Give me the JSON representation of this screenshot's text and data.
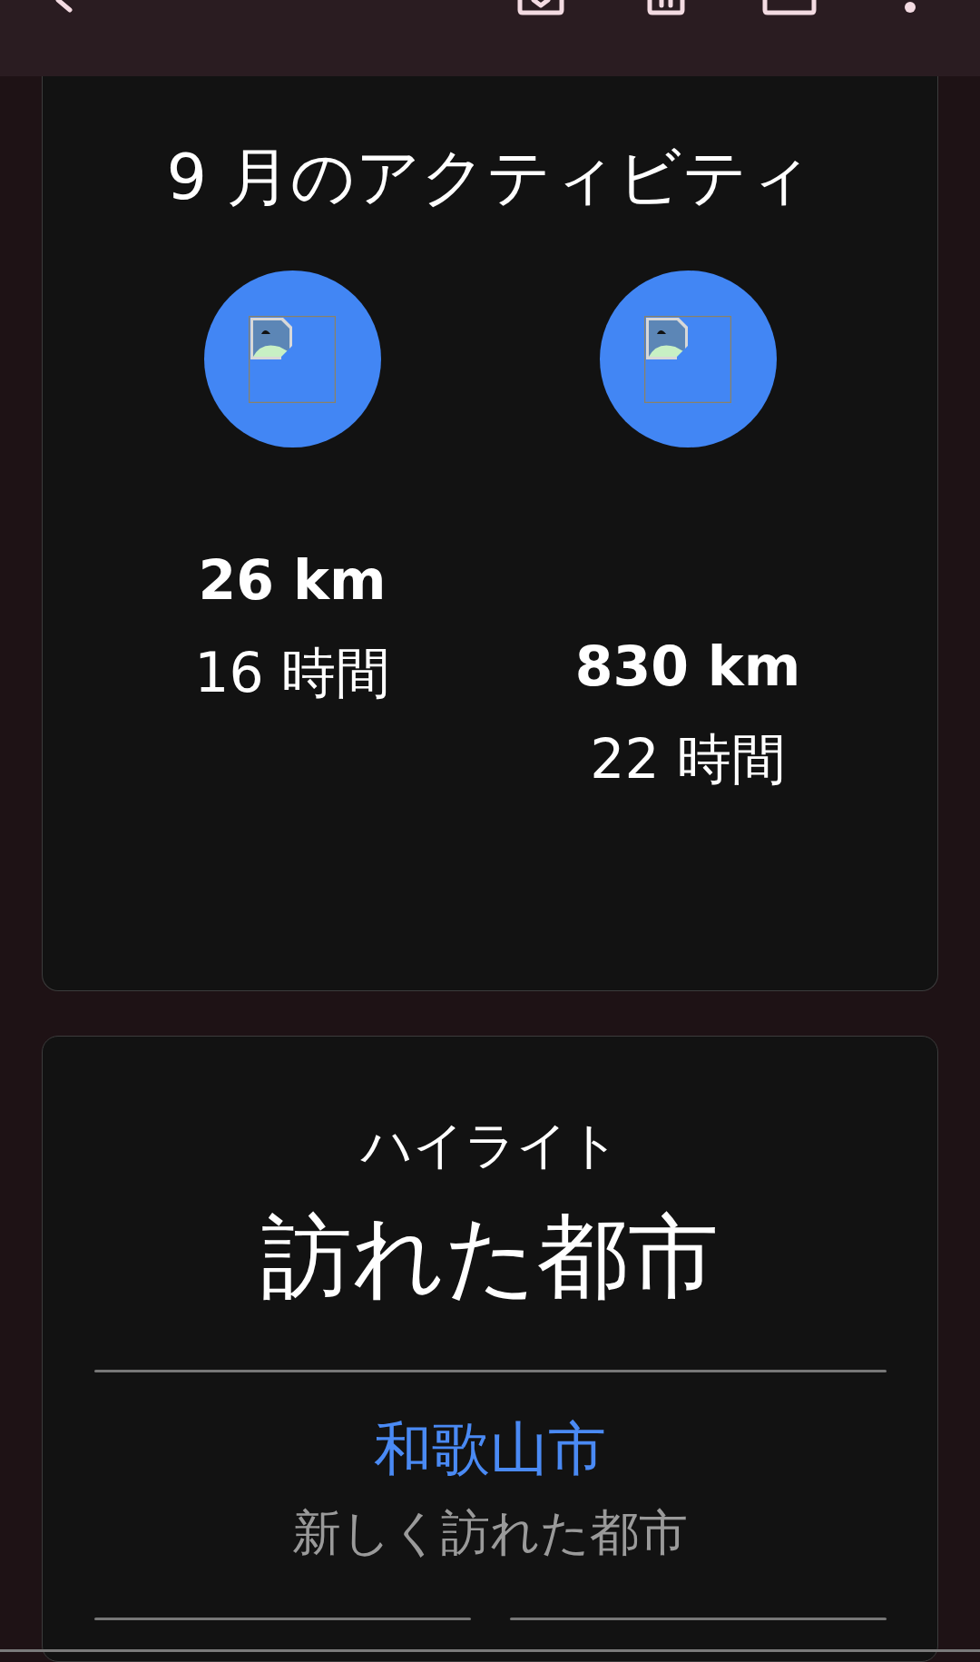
{
  "activity_card": {
    "title": "9 月のアクティビティ",
    "activities": [
      {
        "distance": "26 km",
        "duration": "16 時間"
      },
      {
        "distance": "830 km",
        "duration": "22 時間"
      }
    ]
  },
  "highlight_card": {
    "eyebrow": "ハイライト",
    "title": "訪れた都市",
    "city": "和歌山市",
    "caption": "新しく訪れた都市"
  }
}
